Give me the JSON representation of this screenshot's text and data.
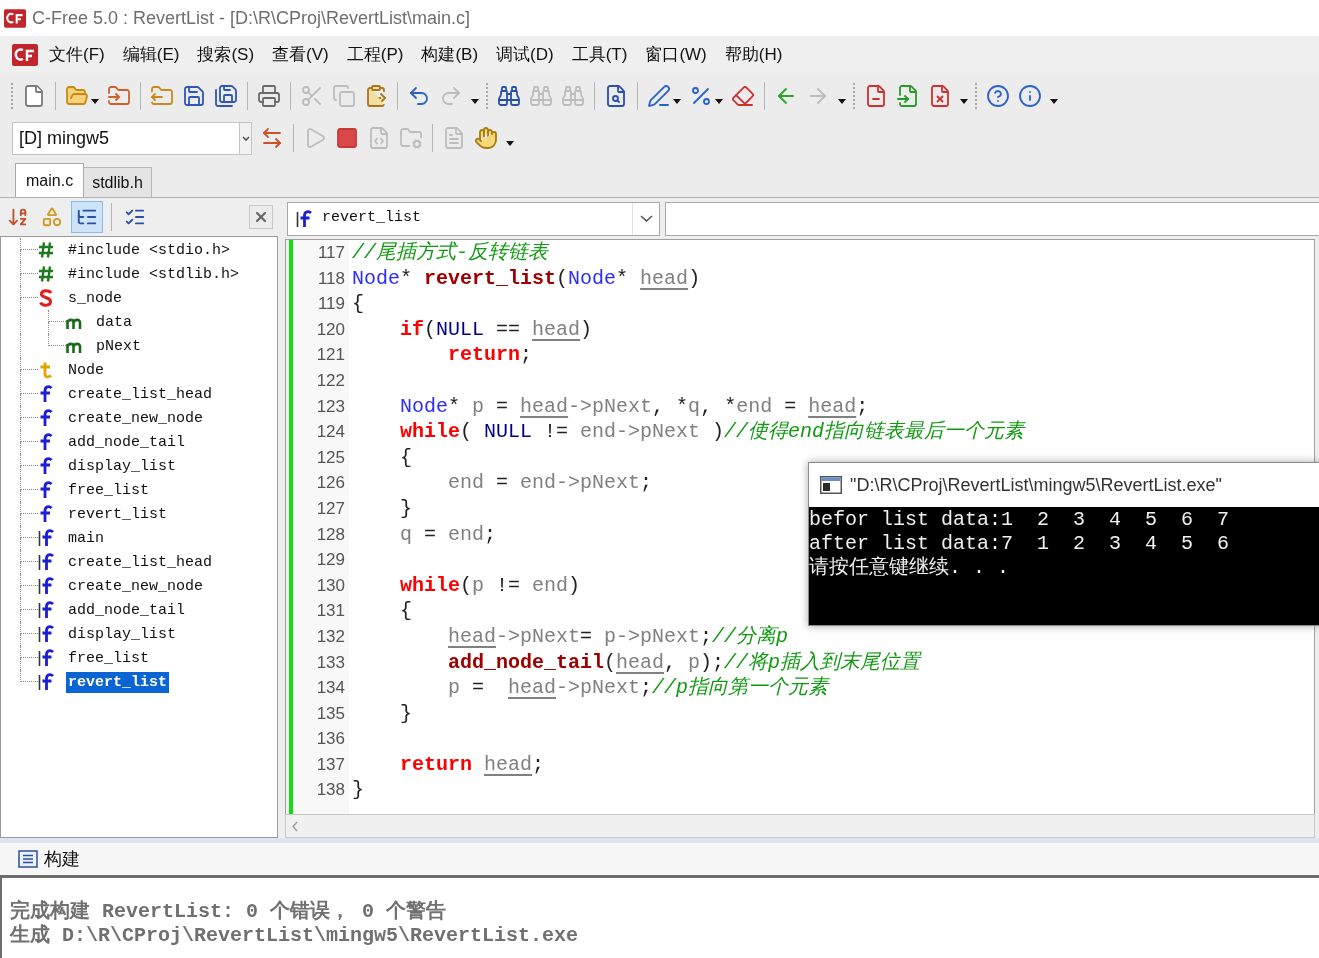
{
  "window": {
    "title": "C-Free 5.0 : RevertList - [D:\\R\\CProj\\RevertList\\main.c]"
  },
  "menu": [
    "文件(F)",
    "编辑(E)",
    "搜索(S)",
    "查看(V)",
    "工程(P)",
    "构建(B)",
    "调试(D)",
    "工具(T)",
    "窗口(W)",
    "帮助(H)"
  ],
  "toolbar": {
    "tools": [
      {
        "kind": "grip"
      },
      {
        "kind": "new-file",
        "disabled": false
      },
      {
        "kind": "separator"
      },
      {
        "kind": "open",
        "disabled": false,
        "dropdown": true
      },
      {
        "kind": "open-project",
        "disabled": false
      },
      {
        "kind": "separator"
      },
      {
        "kind": "project",
        "disabled": false
      },
      {
        "kind": "save",
        "disabled": false
      },
      {
        "kind": "save-all",
        "disabled": false
      },
      {
        "kind": "separator"
      },
      {
        "kind": "print",
        "disabled": false
      },
      {
        "kind": "separator"
      },
      {
        "kind": "cut",
        "disabled": true
      },
      {
        "kind": "copy",
        "disabled": true
      },
      {
        "kind": "paste",
        "disabled": false
      },
      {
        "kind": "separator"
      },
      {
        "kind": "undo",
        "disabled": false
      },
      {
        "kind": "redo",
        "disabled": true
      },
      {
        "kind": "overflow"
      },
      {
        "kind": "grip"
      },
      {
        "kind": "find",
        "disabled": false
      },
      {
        "kind": "find-next",
        "disabled": true
      },
      {
        "kind": "find-prev",
        "disabled": true
      },
      {
        "kind": "separator"
      },
      {
        "kind": "find-files",
        "disabled": false
      },
      {
        "kind": "separator"
      },
      {
        "kind": "pen",
        "disabled": false,
        "dropdown": true
      },
      {
        "kind": "percent",
        "disabled": false,
        "dropdown": true
      },
      {
        "kind": "erase",
        "disabled": false
      },
      {
        "kind": "separator"
      },
      {
        "kind": "back",
        "disabled": false
      },
      {
        "kind": "forward",
        "disabled": true
      },
      {
        "kind": "overflow"
      },
      {
        "kind": "grip"
      },
      {
        "kind": "doc-minus",
        "disabled": false
      },
      {
        "kind": "doc-arrow",
        "disabled": false
      },
      {
        "kind": "doc-x",
        "disabled": false
      },
      {
        "kind": "overflow"
      },
      {
        "kind": "grip"
      },
      {
        "kind": "help",
        "disabled": false
      },
      {
        "kind": "info",
        "disabled": false
      },
      {
        "kind": "overflow"
      }
    ]
  },
  "build_toolbar": {
    "compiler": "[D] mingw5",
    "tools": [
      {
        "kind": "switch",
        "disabled": false
      },
      {
        "kind": "separator"
      },
      {
        "kind": "run",
        "disabled": true
      },
      {
        "kind": "stop",
        "disabled": false
      },
      {
        "kind": "compile",
        "disabled": true
      },
      {
        "kind": "build",
        "disabled": true
      },
      {
        "kind": "separator"
      },
      {
        "kind": "doc-list",
        "disabled": true
      },
      {
        "kind": "hand",
        "disabled": false
      },
      {
        "kind": "overflow"
      }
    ]
  },
  "file_tabs": [
    {
      "label": "main.c",
      "selected": true
    },
    {
      "label": "stdlib.h",
      "selected": false
    }
  ],
  "symbol_panel": {
    "tools": [
      {
        "kind": "sort",
        "selected": false
      },
      {
        "kind": "classes",
        "selected": false
      },
      {
        "kind": "outline",
        "selected": true
      },
      {
        "kind": "separator"
      },
      {
        "kind": "checklist",
        "selected": false
      }
    ],
    "tree": [
      {
        "label": "#include <stdio.h>",
        "kind": "include",
        "selected": false
      },
      {
        "label": "#include <stdlib.h>",
        "kind": "include",
        "selected": false
      },
      {
        "label": "s_node",
        "kind": "struct",
        "selected": false,
        "children": [
          {
            "label": "data",
            "kind": "member",
            "selected": false
          },
          {
            "label": "pNext",
            "kind": "member",
            "selected": false
          }
        ]
      },
      {
        "label": "Node",
        "kind": "typedef",
        "selected": false
      },
      {
        "label": "create_list_head",
        "kind": "declaration",
        "selected": false
      },
      {
        "label": "create_new_node",
        "kind": "declaration",
        "selected": false
      },
      {
        "label": "add_node_tail",
        "kind": "declaration",
        "selected": false
      },
      {
        "label": "display_list",
        "kind": "declaration",
        "selected": false
      },
      {
        "label": "free_list",
        "kind": "declaration",
        "selected": false
      },
      {
        "label": "revert_list",
        "kind": "declaration",
        "selected": false
      },
      {
        "label": "main",
        "kind": "definition",
        "selected": false
      },
      {
        "label": "create_list_head",
        "kind": "definition",
        "selected": false
      },
      {
        "label": "create_new_node",
        "kind": "definition",
        "selected": false
      },
      {
        "label": "add_node_tail",
        "kind": "definition",
        "selected": false
      },
      {
        "label": "display_list",
        "kind": "definition",
        "selected": false
      },
      {
        "label": "free_list",
        "kind": "definition",
        "selected": false
      },
      {
        "label": "revert_list",
        "kind": "definition",
        "selected": true
      }
    ]
  },
  "editor": {
    "function": "revert_list",
    "lines": [
      {
        "number": "117",
        "tokens": [
          {
            "kind": "comment",
            "text": "//尾插方式-反转链表"
          }
        ]
      },
      {
        "number": "118",
        "tokens": [
          {
            "kind": "type",
            "text": "Node"
          },
          {
            "kind": "op",
            "text": "* "
          },
          {
            "kind": "function",
            "text": "revert_list"
          },
          {
            "kind": "op",
            "text": "("
          },
          {
            "kind": "type",
            "text": "Node"
          },
          {
            "kind": "op",
            "text": "* "
          },
          {
            "kind": "param",
            "text": "head"
          },
          {
            "kind": "op",
            "text": ")"
          }
        ]
      },
      {
        "number": "119",
        "tokens": [
          {
            "kind": "op",
            "text": "{"
          }
        ],
        "children": [
          {
            "number": "120",
            "tokens": [
              {
                "kind": "keyword",
                "text": "if"
              },
              {
                "kind": "op",
                "text": "("
              },
              {
                "kind": "constant",
                "text": "NULL"
              },
              {
                "kind": "op",
                "text": " == "
              },
              {
                "kind": "param",
                "text": "head"
              },
              {
                "kind": "op",
                "text": ")"
              }
            ],
            "children": [
              {
                "number": "121",
                "tokens": [
                  {
                    "kind": "keyword",
                    "text": "return"
                  },
                  {
                    "kind": "op",
                    "text": ";"
                  }
                ]
              }
            ]
          },
          {
            "number": "122"
          },
          {
            "number": "123",
            "tokens": [
              {
                "kind": "type",
                "text": "Node"
              },
              {
                "kind": "op",
                "text": "* "
              },
              {
                "kind": "ident",
                "text": "p"
              },
              {
                "kind": "op",
                "text": " = "
              },
              {
                "kind": "param",
                "text": "head"
              },
              {
                "kind": "ident",
                "text": "->pNext"
              },
              {
                "kind": "op",
                "text": ", *"
              },
              {
                "kind": "ident",
                "text": "q"
              },
              {
                "kind": "op",
                "text": ", *"
              },
              {
                "kind": "ident",
                "text": "end"
              },
              {
                "kind": "op",
                "text": " = "
              },
              {
                "kind": "param",
                "text": "head"
              },
              {
                "kind": "op",
                "text": ";"
              }
            ]
          },
          {
            "number": "124",
            "tokens": [
              {
                "kind": "keyword",
                "text": "while"
              },
              {
                "kind": "op",
                "text": "( "
              },
              {
                "kind": "constant",
                "text": "NULL"
              },
              {
                "kind": "op",
                "text": " != "
              },
              {
                "kind": "ident",
                "text": "end->pNext"
              },
              {
                "kind": "op",
                "text": " )"
              },
              {
                "kind": "comment",
                "text": "//使得end指向链表最后一个元素"
              }
            ]
          },
          {
            "number": "125",
            "tokens": [
              {
                "kind": "op",
                "text": "{"
              }
            ],
            "children": [
              {
                "number": "126",
                "tokens": [
                  {
                    "kind": "ident",
                    "text": "end"
                  },
                  {
                    "kind": "op",
                    "text": " = "
                  },
                  {
                    "kind": "ident",
                    "text": "end->pNext"
                  },
                  {
                    "kind": "op",
                    "text": ";"
                  }
                ]
              }
            ]
          },
          {
            "number": "127",
            "tokens": [
              {
                "kind": "op",
                "text": "}"
              }
            ]
          },
          {
            "number": "128",
            "tokens": [
              {
                "kind": "ident",
                "text": "q"
              },
              {
                "kind": "op",
                "text": " = "
              },
              {
                "kind": "ident",
                "text": "end"
              },
              {
                "kind": "op",
                "text": ";"
              }
            ]
          },
          {
            "number": "129"
          },
          {
            "number": "130",
            "tokens": [
              {
                "kind": "keyword",
                "text": "while"
              },
              {
                "kind": "op",
                "text": "("
              },
              {
                "kind": "ident",
                "text": "p"
              },
              {
                "kind": "op",
                "text": " != "
              },
              {
                "kind": "ident",
                "text": "end"
              },
              {
                "kind": "op",
                "text": ")"
              }
            ]
          },
          {
            "number": "131",
            "tokens": [
              {
                "kind": "op",
                "text": "{"
              }
            ],
            "children": [
              {
                "number": "132",
                "tokens": [
                  {
                    "kind": "param",
                    "text": "head"
                  },
                  {
                    "kind": "ident",
                    "text": "->pNext"
                  },
                  {
                    "kind": "op",
                    "text": "= "
                  },
                  {
                    "kind": "ident",
                    "text": "p->pNext"
                  },
                  {
                    "kind": "op",
                    "text": ";"
                  },
                  {
                    "kind": "comment",
                    "text": "//分离p"
                  }
                ]
              },
              {
                "number": "133",
                "tokens": [
                  {
                    "kind": "function",
                    "text": "add_node_tail"
                  },
                  {
                    "kind": "op",
                    "text": "("
                  },
                  {
                    "kind": "param",
                    "text": "head"
                  },
                  {
                    "kind": "op",
                    "text": ", "
                  },
                  {
                    "kind": "ident",
                    "text": "p"
                  },
                  {
                    "kind": "op",
                    "text": ");"
                  },
                  {
                    "kind": "comment",
                    "text": "//将p插入到末尾位置"
                  }
                ]
              },
              {
                "number": "134",
                "tokens": [
                  {
                    "kind": "ident",
                    "text": "p"
                  },
                  {
                    "kind": "op",
                    "text": " =  "
                  },
                  {
                    "kind": "param",
                    "text": "head"
                  },
                  {
                    "kind": "ident",
                    "text": "->pNext"
                  },
                  {
                    "kind": "op",
                    "text": ";"
                  },
                  {
                    "kind": "comment",
                    "text": "//p指向第一个元素"
                  }
                ]
              }
            ]
          },
          {
            "number": "135",
            "tokens": [
              {
                "kind": "op",
                "text": "}"
              }
            ]
          },
          {
            "number": "136"
          },
          {
            "number": "137",
            "tokens": [
              {
                "kind": "keyword",
                "text": "return "
              },
              {
                "kind": "param",
                "text": "head"
              },
              {
                "kind": "op",
                "text": ";"
              }
            ]
          }
        ]
      },
      {
        "number": "138",
        "tokens": [
          {
            "kind": "op",
            "text": "}"
          }
        ]
      }
    ]
  },
  "console": {
    "title": "\"D:\\R\\CProj\\RevertList\\mingw5\\RevertList.exe\"",
    "lines": [
      "befor list data:1  2  3  4  5  6  7",
      "after list data:7  1  2  3  4  5  6",
      "请按任意键继续. . ."
    ]
  },
  "output": {
    "tab": "构建",
    "lines": [
      "完成构建 RevertList: 0 个错误， 0 个警告",
      "生成 D:\\R\\CProj\\RevertList\\mingw5\\RevertList.exe"
    ]
  }
}
